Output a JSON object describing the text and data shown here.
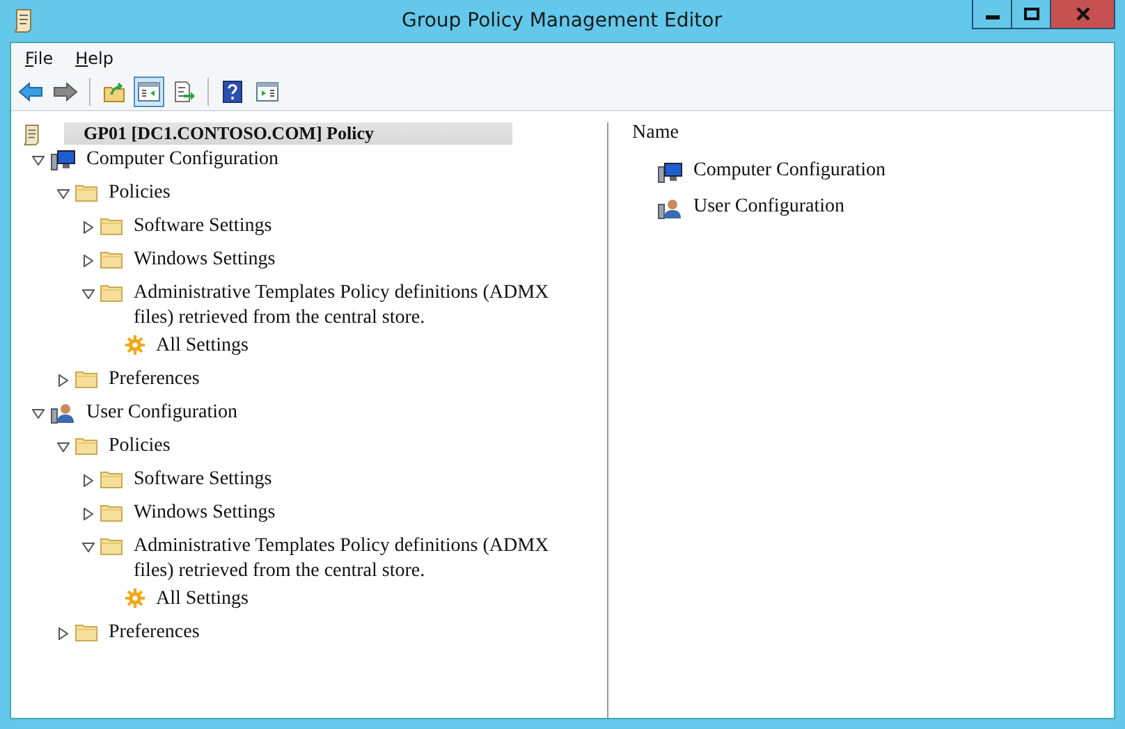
{
  "window": {
    "title": "Group Policy Management Editor",
    "controls": [
      {
        "kind": "minimize"
      },
      {
        "kind": "maximize"
      },
      {
        "kind": "close"
      }
    ]
  },
  "menu": [
    {
      "access_key": "F",
      "rest": "ile"
    },
    {
      "access_key": "H",
      "rest": "elp"
    }
  ],
  "toolbar": [
    {
      "kind": "back",
      "pressed": false
    },
    {
      "kind": "forward",
      "pressed": false
    },
    {
      "kind": "separator"
    },
    {
      "kind": "up",
      "pressed": false
    },
    {
      "kind": "tree",
      "pressed": true
    },
    {
      "kind": "export",
      "pressed": false
    },
    {
      "kind": "separator"
    },
    {
      "kind": "help",
      "pressed": false
    },
    {
      "kind": "pane",
      "pressed": false
    }
  ],
  "tree": {
    "label": "GP01 [DC1.CONTOSO.COM] Policy",
    "children": [
      {
        "kind": "computer",
        "label": "Computer Configuration",
        "expanded": true,
        "children": [
          {
            "kind": "folder",
            "label": "Policies",
            "expanded": true,
            "children": [
              {
                "kind": "folder",
                "label": "Software Settings",
                "expanded": false
              },
              {
                "kind": "folder",
                "label": "Windows Settings",
                "expanded": false
              },
              {
                "kind": "folder",
                "label": "Administrative Templates Policy definitions (ADMX files) retrieved from the central store.",
                "expanded": true,
                "children": [
                  {
                    "kind": "settings",
                    "label": "All Settings"
                  }
                ]
              }
            ]
          },
          {
            "kind": "folder",
            "label": "Preferences",
            "expanded": false
          }
        ]
      },
      {
        "kind": "user",
        "label": "User Configuration",
        "expanded": true,
        "children": [
          {
            "kind": "folder",
            "label": "Policies",
            "expanded": true,
            "children": [
              {
                "kind": "folder",
                "label": "Software Settings",
                "expanded": false
              },
              {
                "kind": "folder",
                "label": "Windows Settings",
                "expanded": false
              },
              {
                "kind": "folder",
                "label": "Administrative Templates Policy definitions (ADMX files) retrieved from the central store.",
                "expanded": true,
                "children": [
                  {
                    "kind": "settings",
                    "label": "All Settings"
                  }
                ]
              }
            ]
          },
          {
            "kind": "folder",
            "label": "Preferences",
            "expanded": false
          }
        ]
      }
    ]
  },
  "list": {
    "column": "Name",
    "items": [
      {
        "kind": "computer",
        "label": "Computer Configuration"
      },
      {
        "kind": "user",
        "label": "User Configuration"
      }
    ]
  }
}
